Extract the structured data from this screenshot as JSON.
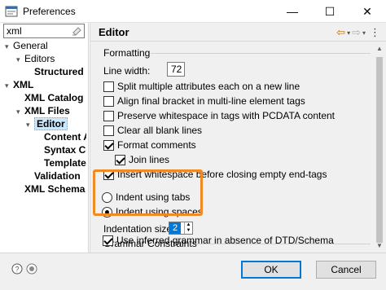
{
  "window": {
    "title": "Preferences",
    "minimize_glyph": "—",
    "maximize_glyph": "☐",
    "close_glyph": "✕"
  },
  "filter": {
    "value": "xml"
  },
  "tree": {
    "items": [
      {
        "label": "General",
        "arrow": "▾",
        "bold": false
      },
      {
        "label": "Editors",
        "arrow": "▾",
        "bold": false
      },
      {
        "label": "Structured Te:",
        "arrow": "",
        "bold": true
      },
      {
        "label": "XML",
        "arrow": "▾",
        "bold": true
      },
      {
        "label": "XML Catalog",
        "arrow": "",
        "bold": true
      },
      {
        "label": "XML Files",
        "arrow": "▾",
        "bold": true
      },
      {
        "label": "Editor",
        "arrow": "▾",
        "bold": true,
        "selected": true
      },
      {
        "label": "Content As",
        "arrow": "",
        "bold": true
      },
      {
        "label": "Syntax Colo",
        "arrow": "",
        "bold": true
      },
      {
        "label": "Templates",
        "arrow": "",
        "bold": true
      },
      {
        "label": "Validation",
        "arrow": "",
        "bold": true
      },
      {
        "label": "XML Schema Fil",
        "arrow": "",
        "bold": true
      }
    ]
  },
  "header": {
    "title": "Editor",
    "back_glyph": "⇦",
    "back_menu_glyph": "▾",
    "forward_glyph": "⇨",
    "forward_menu_glyph": "▾",
    "view_menu_glyph": "⋮"
  },
  "formatting": {
    "section_label": "Formatting",
    "line_width_label": "Line width:",
    "line_width_value": "72",
    "options": [
      {
        "label": "Split multiple attributes each on a new line",
        "checked": false
      },
      {
        "label": "Align final bracket in multi-line element tags",
        "checked": false
      },
      {
        "label": "Preserve whitespace in tags with PCDATA content",
        "checked": false
      },
      {
        "label": "Clear all blank lines",
        "checked": false
      },
      {
        "label": "Format comments",
        "checked": true
      },
      {
        "label": "Join lines",
        "checked": true
      },
      {
        "label": "Insert whitespace before closing empty end-tags",
        "checked": true
      }
    ],
    "indent_tabs_label": "Indent using tabs",
    "indent_spaces_label": "Indent using spaces",
    "indent_choice": "spaces",
    "indentation_size_label": "Indentation size:",
    "indentation_size_value": "2"
  },
  "grammar": {
    "section_label": "Grammar Constraints",
    "option_label": "Use inferred grammar in absence of DTD/Schema",
    "checked": true
  },
  "footer": {
    "ok_label": "OK",
    "cancel_label": "Cancel"
  },
  "colors": {
    "highlight": "#f08a24",
    "selection": "#0078d7",
    "nav_icons": "#c07000"
  }
}
